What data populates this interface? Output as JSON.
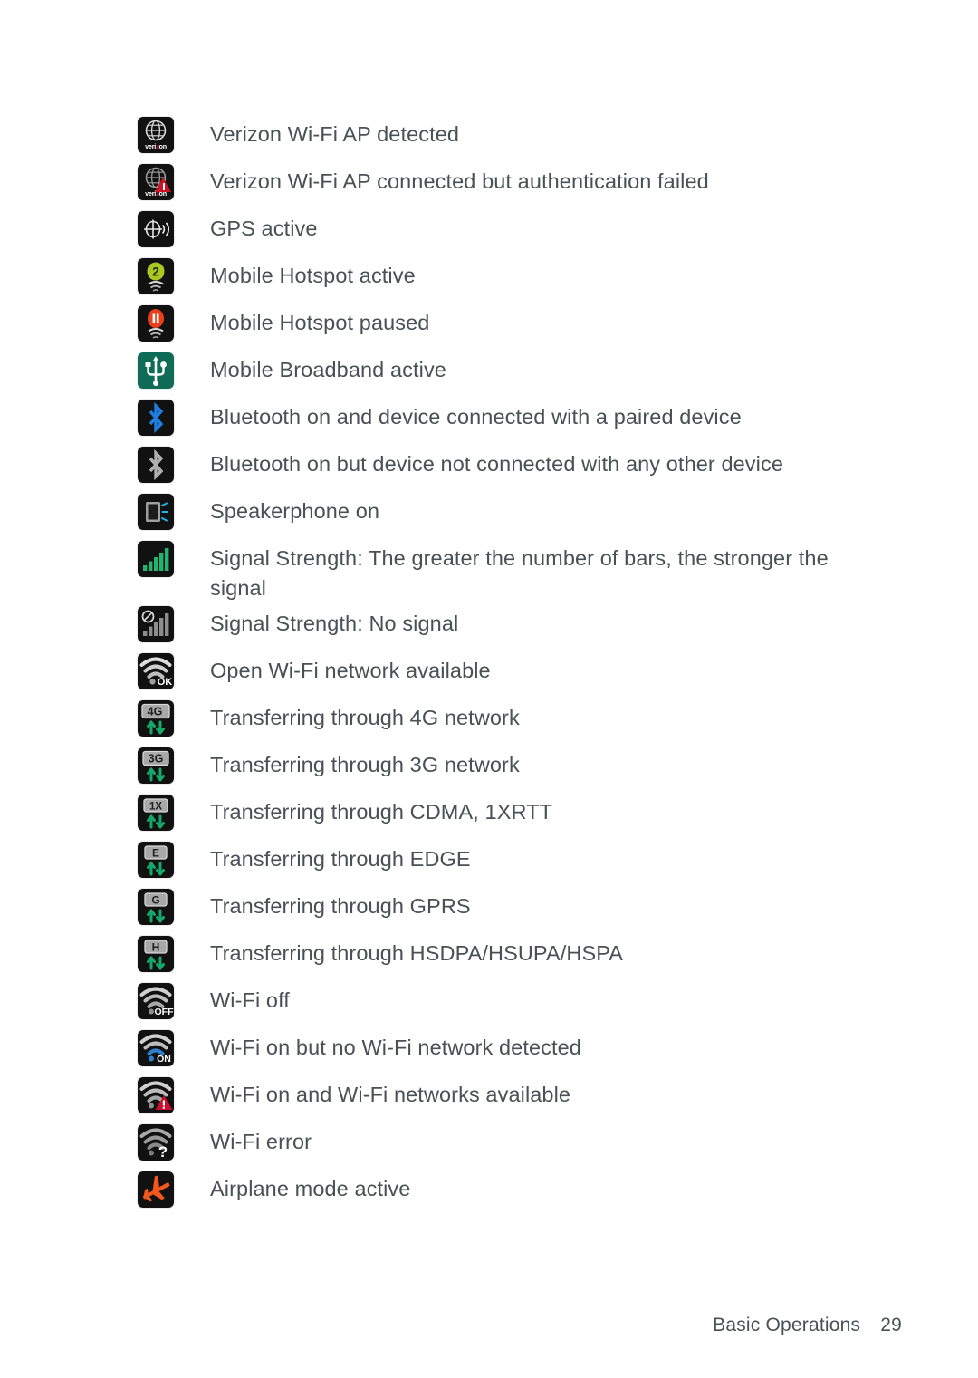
{
  "page": {
    "footer_section": "Basic Operations",
    "footer_page_number": "29"
  },
  "colors": {
    "tile_background": "#111111",
    "broadband_tile_background": "#0e6b55",
    "text": "#4a5055",
    "signal_green": "#21b573",
    "bluetooth_blue": "#1e7fe0",
    "hotspot_green": "#aac820",
    "hotspot_paused_red": "#e8401a",
    "airplane_orange": "#f2581d",
    "verizon_red": "#e8122b",
    "alert_red": "#d01025",
    "wifi_on_blue": "#2f7fd0",
    "signal_gray": "#8d8d8d"
  },
  "rows": [
    {
      "icon": "verizon-wifi-ap-detected-icon",
      "label": "Verizon Wi-Fi AP detected"
    },
    {
      "icon": "verizon-wifi-ap-auth-failed-icon",
      "label": "Verizon Wi-Fi AP connected but authentication failed"
    },
    {
      "icon": "gps-active-icon",
      "label": "GPS active"
    },
    {
      "icon": "mobile-hotspot-active-icon",
      "label": "Mobile Hotspot active"
    },
    {
      "icon": "mobile-hotspot-paused-icon",
      "label": "Mobile Hotspot paused"
    },
    {
      "icon": "mobile-broadband-active-icon",
      "label": "Mobile Broadband active"
    },
    {
      "icon": "bluetooth-connected-icon",
      "label": "Bluetooth on and device connected with a paired device"
    },
    {
      "icon": "bluetooth-on-icon",
      "label": "Bluetooth on but device not connected with any other device"
    },
    {
      "icon": "speakerphone-on-icon",
      "label": "Speakerphone on"
    },
    {
      "icon": "signal-strength-bars-icon",
      "label": "Signal Strength: The greater the number of bars, the stronger the signal"
    },
    {
      "icon": "signal-strength-none-icon",
      "label": "Signal Strength: No signal"
    },
    {
      "icon": "open-wifi-network-icon",
      "label": "Open Wi-Fi network available"
    },
    {
      "icon": "transfer-4g-icon",
      "label": "Transferring through 4G network"
    },
    {
      "icon": "transfer-3g-icon",
      "label": "Transferring through 3G network"
    },
    {
      "icon": "transfer-1x-icon",
      "label": "Transferring through CDMA, 1XRTT"
    },
    {
      "icon": "transfer-edge-icon",
      "label": "Transferring through EDGE"
    },
    {
      "icon": "transfer-gprs-icon",
      "label": "Transferring through GPRS"
    },
    {
      "icon": "transfer-hsdpa-icon",
      "label": "Transferring through HSDPA/HSUPA/HSPA"
    },
    {
      "icon": "wifi-off-icon",
      "label": "Wi-Fi off"
    },
    {
      "icon": "wifi-on-no-network-icon",
      "label": "Wi-Fi on but no Wi-Fi network detected"
    },
    {
      "icon": "wifi-on-networks-available-icon",
      "label": "Wi-Fi on and Wi-Fi networks available"
    },
    {
      "icon": "wifi-error-icon",
      "label": "Wi-Fi error"
    },
    {
      "icon": "airplane-mode-icon",
      "label": "Airplane mode active"
    }
  ],
  "icon_text": {
    "verizon_word_pre": "veri",
    "verizon_word_z": "z",
    "verizon_word_post": "on",
    "wifi_ok_badge": "OK",
    "wifi_off_badge": "OFF",
    "wifi_on_badge": "ON",
    "wifi_error_badge": "?",
    "net_4g": "4G",
    "net_3g": "3G",
    "net_1x": "1X",
    "net_edge": "E",
    "net_gprs": "G",
    "net_hsdpa": "H"
  }
}
